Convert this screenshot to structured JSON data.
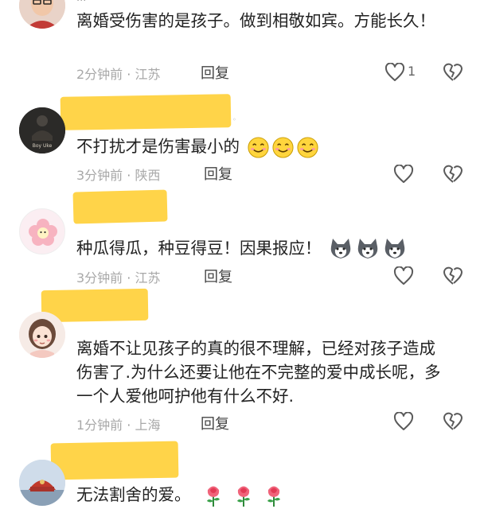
{
  "top_partial": "···",
  "comments": [
    {
      "text": "离婚受伤害的是孩子。做到相敬如宾。方能长久！",
      "time": "2分钟前",
      "sep": "·",
      "location": "江苏",
      "reply": "回复",
      "likes": "1",
      "avatar_colors": {
        "bg": "#e9d3c8",
        "accent": "#c23b36"
      }
    },
    {
      "text": "不打扰才是伤害最小的",
      "time": "3分钟前",
      "sep": "·",
      "location": "陕西",
      "reply": "回复",
      "likes": "",
      "avatar_text": "Boy Uke",
      "avatar_colors": {
        "bg": "#2b2a28",
        "accent": "#d9d1c2"
      }
    },
    {
      "text": "种瓜得瓜，种豆得豆！因果报应！",
      "time": "3分钟前",
      "sep": "·",
      "location": "江苏",
      "reply": "回复",
      "likes": "",
      "avatar_colors": {
        "bg": "#fbe6ec",
        "accent": "#f49aac"
      }
    },
    {
      "text": "离婚不让见孩子的真的很不理解，已经对孩子造成伤害了.为什么还要让他在不完整的爱中成长呢，多一个人爱他呵护他有什么不好.",
      "time": "1分钟前",
      "sep": "·",
      "location": "上海",
      "reply": "回复",
      "likes": "",
      "avatar_colors": {
        "bg": "#f6e7e0",
        "accent": "#6b4a3a"
      }
    },
    {
      "text": "无法割舍的爱。",
      "avatar_colors": {
        "bg": "#c9d7e6",
        "accent": "#c0392b"
      }
    }
  ],
  "colors": {
    "mask": "#ffd449",
    "meta": "#9b9b9b",
    "icon": "#5a5a5a"
  }
}
